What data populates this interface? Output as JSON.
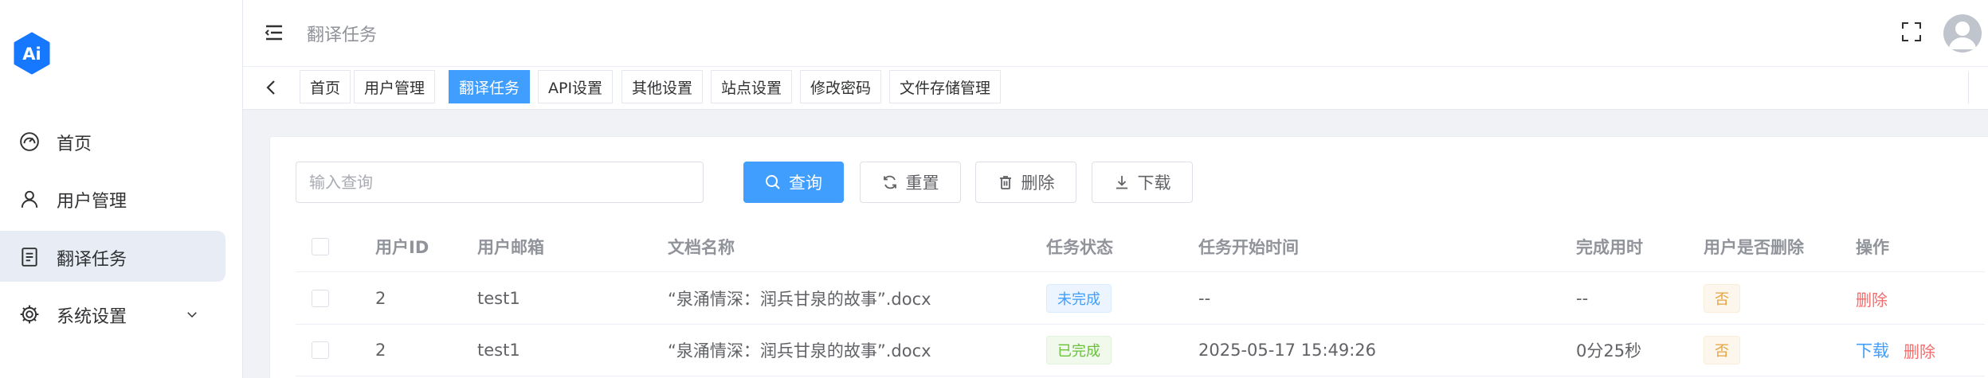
{
  "colors": {
    "primary": "#409eff",
    "logo": "#1677ff",
    "danger": "#f56c6c",
    "success": "#67c23a",
    "warning": "#e6a23c"
  },
  "logo": {
    "text": "Ai"
  },
  "sidebar": {
    "items": [
      {
        "label": "首页",
        "icon": "dashboard-icon"
      },
      {
        "label": "用户管理",
        "icon": "user-icon"
      },
      {
        "label": "翻译任务",
        "icon": "document-icon",
        "active": true
      },
      {
        "label": "系统设置",
        "icon": "gear-icon",
        "expandable": true
      }
    ]
  },
  "header": {
    "breadcrumb": "翻译任务"
  },
  "tabs": [
    {
      "label": "首页"
    },
    {
      "label": "用户管理"
    },
    {
      "label": "翻译任务",
      "active": true
    },
    {
      "label": "API设置"
    },
    {
      "label": "其他设置"
    },
    {
      "label": "站点设置"
    },
    {
      "label": "修改密码"
    },
    {
      "label": "文件存储管理"
    }
  ],
  "search": {
    "placeholder": "输入查询",
    "value": ""
  },
  "toolbar": {
    "query_label": "查询",
    "reset_label": "重置",
    "delete_label": "删除",
    "download_label": "下载"
  },
  "table": {
    "columns": [
      "用户ID",
      "用户邮箱",
      "文档名称",
      "任务状态",
      "任务开始时间",
      "完成用时",
      "用户是否删除",
      "操作"
    ],
    "rows": [
      {
        "user_id": "2",
        "email": "test1",
        "doc": "“泉涌情深：润兵甘泉的故事”.docx",
        "status": "未完成",
        "status_type": "info",
        "start_time": "--",
        "duration": "--",
        "deleted": "否",
        "actions": [
          "删除"
        ]
      },
      {
        "user_id": "2",
        "email": "test1",
        "doc": "“泉涌情深：润兵甘泉的故事”.docx",
        "status": "已完成",
        "status_type": "success",
        "start_time": "2025-05-17 15:49:26",
        "duration": "0分25秒",
        "deleted": "否",
        "actions": [
          "下载",
          "删除"
        ]
      }
    ]
  }
}
